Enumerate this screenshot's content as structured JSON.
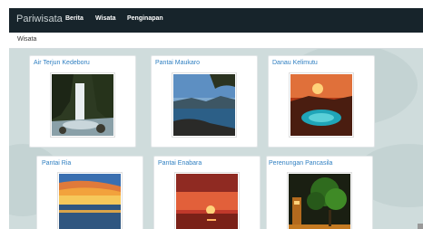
{
  "navbar": {
    "brand": "Pariwisata",
    "links": [
      "Berita",
      "Wisata",
      "Penginapan"
    ]
  },
  "breadcrumb": {
    "current": "Wisata"
  },
  "cards": [
    {
      "title": "Air Terjun Kedeboru",
      "image": "waterfall"
    },
    {
      "title": "Pantai Maukaro",
      "image": "coast"
    },
    {
      "title": "Danau Kelimutu",
      "image": "crater-lake"
    },
    {
      "title": "Pantai Ria",
      "image": "sunset-sea"
    },
    {
      "title": "Pantai Enabara",
      "image": "red-sunset"
    },
    {
      "title": "Perenungan Pancasila",
      "image": "tree-monument"
    }
  ],
  "colors": {
    "navbar": "#17242b",
    "link": "#2f7fc1",
    "background": "#cfdcdc"
  }
}
